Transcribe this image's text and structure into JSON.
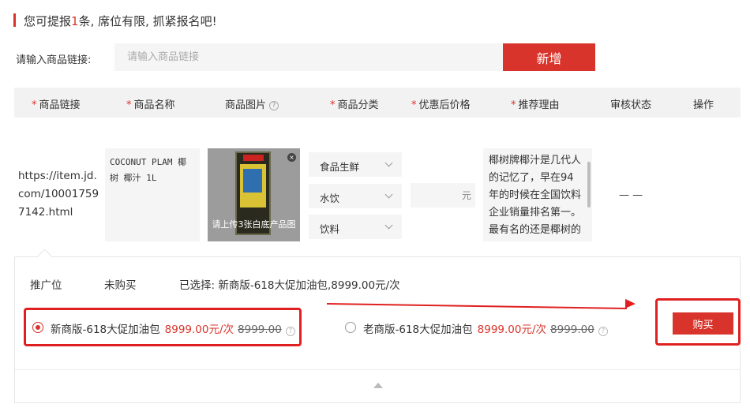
{
  "notice": {
    "prefix": "您可提报",
    "count": "1",
    "suffix": "条, 席位有限, 抓紧报名吧!"
  },
  "link_input": {
    "label": "请输入商品链接:",
    "placeholder": "请输入商品链接",
    "add_button": "新增"
  },
  "table": {
    "headers": [
      {
        "label": "商品链接",
        "required": true
      },
      {
        "label": "商品名称",
        "required": true
      },
      {
        "label": "商品图片",
        "required": false,
        "help": true
      },
      {
        "label": "商品分类",
        "required": true
      },
      {
        "label": "优惠后价格",
        "required": true
      },
      {
        "label": "推荐理由",
        "required": true
      },
      {
        "label": "审核状态",
        "required": false
      },
      {
        "label": "操作",
        "required": false
      }
    ],
    "row": {
      "url": "https://item.jd.com/100017597142.html",
      "name": "COCONUT PLAM 椰树 椰汁 1L",
      "image_caption": "请上传3张白底产品图",
      "categories": [
        "食品生鲜",
        "水饮",
        "饮料"
      ],
      "price_value": "",
      "price_unit": "元",
      "reason": "椰树牌椰汁是几代人的记忆了，早在94年的时候在全国饮料企业销量排名第一。最有名的还是椰树的广告和广告",
      "status": "— —"
    }
  },
  "promo_panel": {
    "slot_label": "推广位",
    "slot_status": "未购买",
    "selected_text": "已选择: 新商版-618大促加油包,8999.00元/次",
    "options": [
      {
        "name": "新商版-618大促加油包",
        "price": "8999.00元/次",
        "original": "8999.00",
        "selected": true
      },
      {
        "name": "老商版-618大促加油包",
        "price": "8999.00元/次",
        "original": "8999.00",
        "selected": false
      }
    ],
    "buy_button": "购买"
  },
  "colors": {
    "accent": "#d9342b",
    "annotation": "#e02020",
    "field_bg": "#f5f5f5",
    "header_bg": "#f2f2f2"
  }
}
